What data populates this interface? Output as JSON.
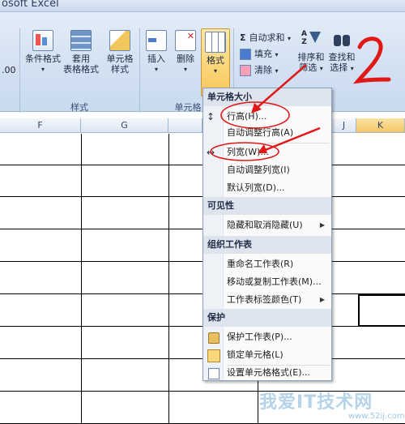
{
  "window": {
    "title": "osoft Excel"
  },
  "ribbon": {
    "styles_group": {
      "label": "样式",
      "conditional_format": "条件格式",
      "table_format_1": "套用",
      "table_format_2": "表格格式",
      "cell_style_1": "单元格",
      "cell_style_2": "样式"
    },
    "cells_group": {
      "label": "单元格",
      "insert": "插入",
      "delete": "删除",
      "format": "格式"
    },
    "editing_group": {
      "autosum": "自动求和",
      "fill": "填充",
      "clear": "清除",
      "sort_1": "排序和",
      "sort_2": "筛选",
      "find_1": "查找和",
      "find_2": "选择"
    },
    "left_fragment": ".00",
    "annotation_digit": "2"
  },
  "columns": [
    "F",
    "G",
    "J",
    "K"
  ],
  "menu": {
    "sections": {
      "cell_size": "单元格大小",
      "visibility": "可见性",
      "organize": "组织工作表",
      "protect": "保护"
    },
    "items": {
      "row_height": "行高(H)...",
      "autofit_row": "自动调整行高(A)",
      "col_width": "列宽(W)...",
      "autofit_col": "自动调整列宽(I)",
      "default_width": "默认列宽(D)...",
      "hide_unhide": "隐藏和取消隐藏(U)",
      "rename": "重命名工作表(R)",
      "move_copy": "移动或复制工作表(M)...",
      "tab_color": "工作表标签颜色(T)",
      "protect_sheet": "保护工作表(P)...",
      "lock_cell": "锁定单元格(L)",
      "format_cells": "设置单元格格式(E)..."
    }
  },
  "watermark": {
    "text": "我爱IT技术网",
    "url": "www.52ij.com"
  }
}
